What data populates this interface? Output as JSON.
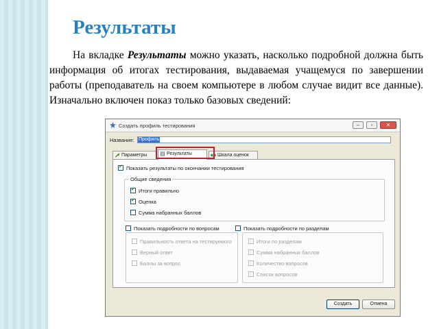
{
  "slide": {
    "title": "Результаты",
    "para_before": "На вкладке ",
    "para_tab": "Результаты",
    "para_after": " можно указать, насколько подробной должна быть информация об итогах тестирования, выдаваемая учащемуся по завершении работы (преподаватель на своем компьютере в любом случае видит все данные). Изначально включен показ только базовых сведений:"
  },
  "dialog": {
    "title": "Создать профиль тестирования",
    "name_label": "Название:",
    "name_value": "Профиль",
    "tabs": [
      {
        "label": "Параметры",
        "icon": "wrench-icon"
      },
      {
        "label": "Результаты",
        "icon": "results-icon"
      },
      {
        "label": "Шкала оценок",
        "icon": "scale-icon"
      }
    ],
    "show_results": {
      "label": "Показать результаты по окончании тестирования",
      "checked": true
    },
    "general": {
      "title": "Общие сведения",
      "items": [
        {
          "label": "Итоги правильно",
          "checked": true
        },
        {
          "label": "Оценка",
          "checked": true
        },
        {
          "label": "Сумма набранных баллов",
          "checked": false
        }
      ]
    },
    "by_question": {
      "title": "Показать подробности по вопросам",
      "checked": false,
      "items": [
        {
          "label": "Правильность ответа на тестируемого",
          "checked": false
        },
        {
          "label": "Верный ответ",
          "checked": false
        },
        {
          "label": "Баллы за вопрос",
          "checked": false
        }
      ]
    },
    "by_section": {
      "title": "Показать подробности по разделам",
      "checked": false,
      "items": [
        {
          "label": "Итоги по разделам",
          "checked": false
        },
        {
          "label": "Сумма набранных баллов",
          "checked": false
        },
        {
          "label": "Количество вопросов",
          "checked": false
        },
        {
          "label": "Список вопросов",
          "checked": false
        }
      ]
    },
    "buttons": {
      "create": "Создать",
      "cancel": "Отмена"
    },
    "highlight_color": "#d1172b"
  }
}
